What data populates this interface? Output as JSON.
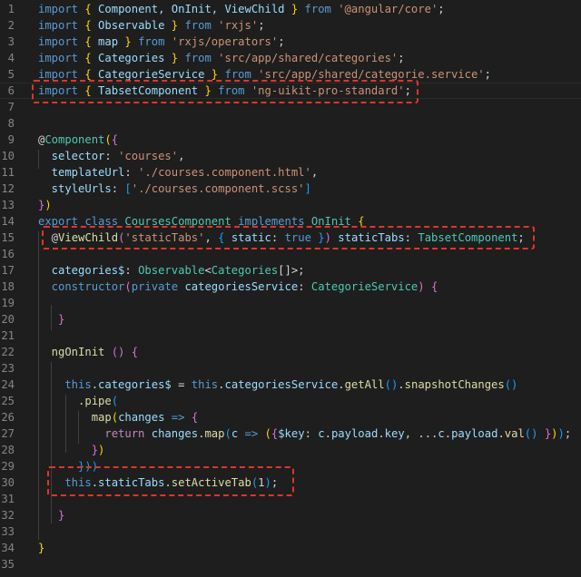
{
  "editor": {
    "background": "#1e1e1e",
    "lines": [
      {
        "n": "1",
        "t": [
          [
            "import",
            "kw"
          ],
          [
            " ",
            "punc"
          ],
          [
            "{",
            "br1"
          ],
          [
            " Component, OnInit, ViewChild ",
            "id"
          ],
          [
            "}",
            "br1"
          ],
          [
            " from ",
            "kw"
          ],
          [
            "'@angular/core'",
            "str"
          ],
          [
            ";",
            "punc"
          ]
        ]
      },
      {
        "n": "2",
        "t": [
          [
            "import",
            "kw"
          ],
          [
            " ",
            "punc"
          ],
          [
            "{",
            "br1"
          ],
          [
            " Observable ",
            "id"
          ],
          [
            "}",
            "br1"
          ],
          [
            " from ",
            "kw"
          ],
          [
            "'rxjs'",
            "str"
          ],
          [
            ";",
            "punc"
          ]
        ]
      },
      {
        "n": "3",
        "t": [
          [
            "import",
            "kw"
          ],
          [
            " ",
            "punc"
          ],
          [
            "{",
            "br1"
          ],
          [
            " map ",
            "id"
          ],
          [
            "}",
            "br1"
          ],
          [
            " from ",
            "kw"
          ],
          [
            "'rxjs/operators'",
            "str"
          ],
          [
            ";",
            "punc"
          ]
        ]
      },
      {
        "n": "4",
        "t": [
          [
            "import",
            "kw"
          ],
          [
            " ",
            "punc"
          ],
          [
            "{",
            "br1"
          ],
          [
            " Categories ",
            "id"
          ],
          [
            "}",
            "br1"
          ],
          [
            " from ",
            "kw"
          ],
          [
            "'src/app/shared/categories'",
            "str"
          ],
          [
            ";",
            "punc"
          ]
        ]
      },
      {
        "n": "5",
        "t": [
          [
            "import",
            "kw"
          ],
          [
            " ",
            "punc"
          ],
          [
            "{",
            "br1"
          ],
          [
            " CategorieService ",
            "id"
          ],
          [
            "}",
            "br1"
          ],
          [
            " from ",
            "kw"
          ],
          [
            "'src/app/shared/categorie.service'",
            "str"
          ],
          [
            ";",
            "punc"
          ]
        ]
      },
      {
        "n": "6",
        "t": [
          [
            "import",
            "kw"
          ],
          [
            " ",
            "punc"
          ],
          [
            "{",
            "br1"
          ],
          [
            " TabsetComponent ",
            "id"
          ],
          [
            "}",
            "br1"
          ],
          [
            " from ",
            "kw"
          ],
          [
            "'ng-uikit-pro-standard'",
            "str"
          ],
          [
            ";",
            "punc"
          ]
        ]
      },
      {
        "n": "7",
        "t": []
      },
      {
        "n": "8",
        "t": []
      },
      {
        "n": "9",
        "t": [
          [
            "@",
            "punc"
          ],
          [
            "Component",
            "type"
          ],
          [
            "(",
            "br1"
          ],
          [
            "{",
            "br2"
          ]
        ]
      },
      {
        "n": "10",
        "t": [
          [
            "  selector",
            "id"
          ],
          [
            ": ",
            "punc"
          ],
          [
            "'courses'",
            "str"
          ],
          [
            ",",
            "punc"
          ]
        ]
      },
      {
        "n": "11",
        "t": [
          [
            "  templateUrl",
            "id"
          ],
          [
            ": ",
            "punc"
          ],
          [
            "'./courses.component.html'",
            "str"
          ],
          [
            ",",
            "punc"
          ]
        ]
      },
      {
        "n": "12",
        "t": [
          [
            "  styleUrls",
            "id"
          ],
          [
            ": ",
            "punc"
          ],
          [
            "[",
            "br3"
          ],
          [
            "'./courses.component.scss'",
            "str"
          ],
          [
            "]",
            "br3"
          ]
        ]
      },
      {
        "n": "13",
        "t": [
          [
            "}",
            "br2"
          ],
          [
            ")",
            "br1"
          ]
        ]
      },
      {
        "n": "14",
        "t": [
          [
            "export",
            "kw"
          ],
          [
            " ",
            "punc"
          ],
          [
            "class",
            "kw"
          ],
          [
            " ",
            "punc"
          ],
          [
            "CoursesComponent",
            "type"
          ],
          [
            " ",
            "punc"
          ],
          [
            "implements",
            "kw"
          ],
          [
            " ",
            "punc"
          ],
          [
            "OnInit",
            "type"
          ],
          [
            " ",
            "punc"
          ],
          [
            "{",
            "br1"
          ]
        ]
      },
      {
        "n": "15",
        "t": [
          [
            "  @",
            "punc"
          ],
          [
            "ViewChild",
            "fn"
          ],
          [
            "(",
            "br2"
          ],
          [
            "'staticTabs'",
            "str"
          ],
          [
            ", ",
            "punc"
          ],
          [
            "{",
            "br3"
          ],
          [
            " static",
            "id"
          ],
          [
            ": ",
            "punc"
          ],
          [
            "true",
            "kw"
          ],
          [
            " ",
            "punc"
          ],
          [
            "}",
            "br3"
          ],
          [
            ")",
            "br2"
          ],
          [
            " staticTabs",
            "id"
          ],
          [
            ": ",
            "punc"
          ],
          [
            "TabsetComponent",
            "type"
          ],
          [
            ";",
            "punc"
          ]
        ]
      },
      {
        "n": "16",
        "t": []
      },
      {
        "n": "17",
        "t": [
          [
            "  categories$",
            "id"
          ],
          [
            ": ",
            "punc"
          ],
          [
            "Observable",
            "type"
          ],
          [
            "<",
            "punc"
          ],
          [
            "Categories",
            "type"
          ],
          [
            "[]>;",
            "punc"
          ]
        ]
      },
      {
        "n": "18",
        "t": [
          [
            "  constructor",
            "kw"
          ],
          [
            "(",
            "br2"
          ],
          [
            "private",
            "kw"
          ],
          [
            " categoriesService",
            "id"
          ],
          [
            ": ",
            "punc"
          ],
          [
            "CategorieService",
            "type"
          ],
          [
            ")",
            "br2"
          ],
          [
            " ",
            "punc"
          ],
          [
            "{",
            "br2"
          ]
        ]
      },
      {
        "n": "19",
        "t": []
      },
      {
        "n": "20",
        "t": [
          [
            "   ",
            "punc"
          ],
          [
            "}",
            "br2"
          ]
        ]
      },
      {
        "n": "21",
        "t": []
      },
      {
        "n": "22",
        "t": [
          [
            "  ngOnInit",
            "fn"
          ],
          [
            " ",
            "punc"
          ],
          [
            "()",
            "br2"
          ],
          [
            " ",
            "punc"
          ],
          [
            "{",
            "br2"
          ]
        ]
      },
      {
        "n": "23",
        "t": []
      },
      {
        "n": "24",
        "t": [
          [
            "    this",
            "kw"
          ],
          [
            ".",
            "punc"
          ],
          [
            "categories$",
            "id"
          ],
          [
            " = ",
            "punc"
          ],
          [
            "this",
            "kw"
          ],
          [
            ".",
            "punc"
          ],
          [
            "categoriesService",
            "id"
          ],
          [
            ".",
            "punc"
          ],
          [
            "getAll",
            "fn"
          ],
          [
            "()",
            "br3"
          ],
          [
            ".",
            "punc"
          ],
          [
            "snapshotChanges",
            "fn"
          ],
          [
            "()",
            "br3"
          ]
        ]
      },
      {
        "n": "25",
        "t": [
          [
            "      .",
            "punc"
          ],
          [
            "pipe",
            "fn"
          ],
          [
            "(",
            "br3"
          ]
        ]
      },
      {
        "n": "26",
        "t": [
          [
            "        ",
            "punc"
          ],
          [
            "map",
            "fn"
          ],
          [
            "(",
            "br1"
          ],
          [
            "changes",
            "id"
          ],
          [
            " ",
            "punc"
          ],
          [
            "=>",
            "kw"
          ],
          [
            " ",
            "punc"
          ],
          [
            "{",
            "br2"
          ]
        ]
      },
      {
        "n": "27",
        "t": [
          [
            "          ",
            "punc"
          ],
          [
            "return",
            "ctrl"
          ],
          [
            " changes",
            "id"
          ],
          [
            ".",
            "punc"
          ],
          [
            "map",
            "fn"
          ],
          [
            "(",
            "br3"
          ],
          [
            "c",
            "id"
          ],
          [
            " ",
            "punc"
          ],
          [
            "=>",
            "kw"
          ],
          [
            " ",
            "punc"
          ],
          [
            "(",
            "br1"
          ],
          [
            "{",
            "br2"
          ],
          [
            "$key",
            "id"
          ],
          [
            ": ",
            "punc"
          ],
          [
            "c",
            "id"
          ],
          [
            ".",
            "punc"
          ],
          [
            "payload",
            "id"
          ],
          [
            ".",
            "punc"
          ],
          [
            "key",
            "id"
          ],
          [
            ", ...",
            "punc"
          ],
          [
            "c",
            "id"
          ],
          [
            ".",
            "punc"
          ],
          [
            "payload",
            "id"
          ],
          [
            ".",
            "punc"
          ],
          [
            "val",
            "fn"
          ],
          [
            "()",
            "br3"
          ],
          [
            " ",
            "punc"
          ],
          [
            "}",
            "br2"
          ],
          [
            ")",
            "br1"
          ],
          [
            ")",
            "br3"
          ],
          [
            ";",
            "punc"
          ]
        ]
      },
      {
        "n": "28",
        "t": [
          [
            "        ",
            "punc"
          ],
          [
            "}",
            "br2"
          ],
          [
            ")",
            "br1"
          ]
        ]
      },
      {
        "n": "29",
        "t": [
          [
            "      ",
            "punc"
          ],
          [
            "}))",
            "br3"
          ]
        ]
      },
      {
        "n": "30",
        "t": [
          [
            "    this",
            "kw"
          ],
          [
            ".",
            "punc"
          ],
          [
            "staticTabs",
            "id"
          ],
          [
            ".",
            "punc"
          ],
          [
            "setActiveTab",
            "fn"
          ],
          [
            "(",
            "br3"
          ],
          [
            "1",
            "punc"
          ],
          [
            ")",
            "br3"
          ],
          [
            ";",
            "punc"
          ]
        ]
      },
      {
        "n": "31",
        "t": []
      },
      {
        "n": "32",
        "t": [
          [
            "   ",
            "punc"
          ],
          [
            "}",
            "br2"
          ]
        ]
      },
      {
        "n": "33",
        "t": []
      },
      {
        "n": "34",
        "t": [
          [
            "}",
            "br1"
          ]
        ]
      },
      {
        "n": "35",
        "t": []
      }
    ]
  }
}
